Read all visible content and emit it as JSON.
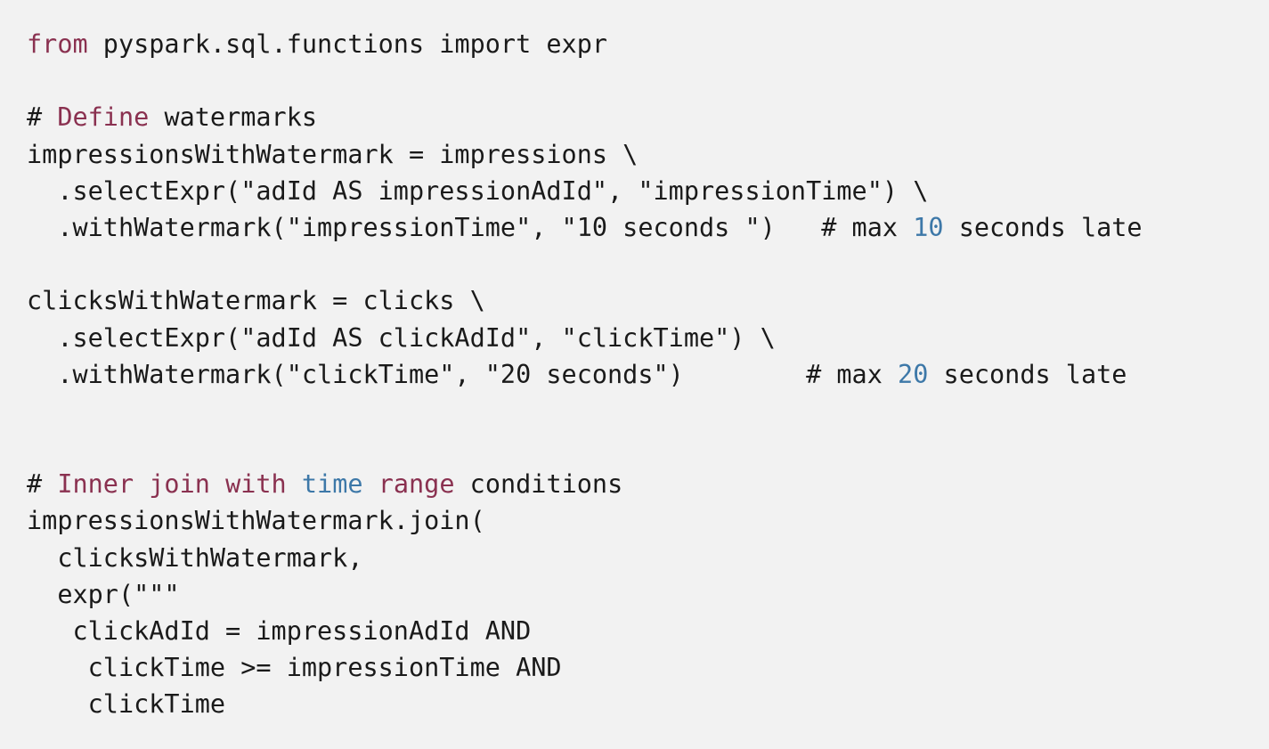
{
  "colors": {
    "background": "#f2f2f2",
    "text": "#1a1a1a",
    "keyword": "#8a3150",
    "number": "#3d78a8"
  },
  "code_lines": [
    [
      {
        "t": "from",
        "c": "kw"
      },
      {
        "t": " pyspark.sql.functions import expr",
        "c": "plain"
      }
    ],
    [],
    [
      {
        "t": "# ",
        "c": "plain"
      },
      {
        "t": "Define",
        "c": "kw"
      },
      {
        "t": " watermarks",
        "c": "plain"
      }
    ],
    [
      {
        "t": "impressionsWithWatermark = impressions \\",
        "c": "plain"
      }
    ],
    [
      {
        "t": "  .selectExpr(\"adId AS impressionAdId\", \"impressionTime\") \\",
        "c": "plain"
      }
    ],
    [
      {
        "t": "  .withWatermark(\"impressionTime\", \"10 seconds \")   # max ",
        "c": "plain"
      },
      {
        "t": "10",
        "c": "num"
      },
      {
        "t": " seconds late",
        "c": "plain"
      }
    ],
    [],
    [
      {
        "t": "clicksWithWatermark = clicks \\",
        "c": "plain"
      }
    ],
    [
      {
        "t": "  .selectExpr(\"adId AS clickAdId\", \"clickTime\") \\",
        "c": "plain"
      }
    ],
    [
      {
        "t": "  .withWatermark(\"clickTime\", \"20 seconds\")        # max ",
        "c": "plain"
      },
      {
        "t": "20",
        "c": "num"
      },
      {
        "t": " seconds late",
        "c": "plain"
      }
    ],
    [],
    [],
    [
      {
        "t": "# ",
        "c": "plain"
      },
      {
        "t": "Inner join with",
        "c": "kw"
      },
      {
        "t": " ",
        "c": "plain"
      },
      {
        "t": "time",
        "c": "num"
      },
      {
        "t": " ",
        "c": "plain"
      },
      {
        "t": "range",
        "c": "kw"
      },
      {
        "t": " conditions",
        "c": "plain"
      }
    ],
    [
      {
        "t": "impressionsWithWatermark.join(",
        "c": "plain"
      }
    ],
    [
      {
        "t": "  clicksWithWatermark,",
        "c": "plain"
      }
    ],
    [
      {
        "t": "  expr(\"\"\"",
        "c": "plain"
      }
    ],
    [
      {
        "t": "   clickAdId = impressionAdId AND",
        "c": "plain"
      }
    ],
    [
      {
        "t": "    clickTime >= impressionTime AND",
        "c": "plain"
      }
    ],
    [
      {
        "t": "    clickTime",
        "c": "plain"
      }
    ]
  ]
}
